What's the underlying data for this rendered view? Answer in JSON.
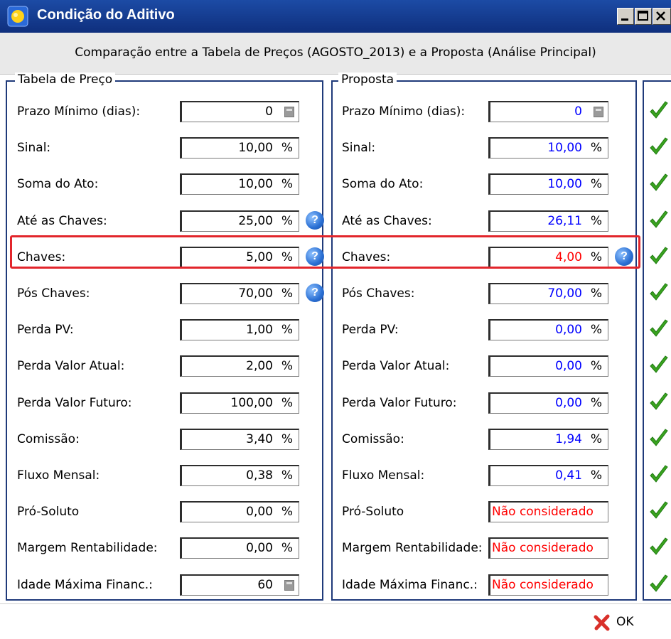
{
  "window": {
    "title": "Condição do Aditivo"
  },
  "header": {
    "subtitle": "Comparação entre a Tabela de Preços (AGOSTO_2013) e a Proposta (Análise Principal)"
  },
  "tabela": {
    "legend": "Tabela de Preço",
    "rows": [
      {
        "label": "Prazo Mínimo (dias):",
        "value": "0",
        "unit": ""
      },
      {
        "label": "Sinal:",
        "value": "10,00",
        "unit": "%"
      },
      {
        "label": "Soma do Ato:",
        "value": "10,00",
        "unit": "%"
      },
      {
        "label": "Até as Chaves:",
        "value": "25,00",
        "unit": "%"
      },
      {
        "label": "Chaves:",
        "value": "5,00",
        "unit": "%"
      },
      {
        "label": "Pós Chaves:",
        "value": "70,00",
        "unit": "%"
      },
      {
        "label": "Perda PV:",
        "value": "1,00",
        "unit": "%"
      },
      {
        "label": "Perda Valor Atual:",
        "value": "2,00",
        "unit": "%"
      },
      {
        "label": "Perda Valor Futuro:",
        "value": "100,00",
        "unit": "%"
      },
      {
        "label": "Comissão:",
        "value": "3,40",
        "unit": "%"
      },
      {
        "label": "Fluxo Mensal:",
        "value": "0,38",
        "unit": "%"
      },
      {
        "label": "Pró-Soluto",
        "value": "0,00",
        "unit": "%"
      },
      {
        "label": "Margem Rentabilidade:",
        "value": "0,00",
        "unit": "%"
      },
      {
        "label": "Idade Máxima Financ.:",
        "value": "60",
        "unit": ""
      }
    ]
  },
  "proposta": {
    "legend": "Proposta",
    "rows": [
      {
        "label": "Prazo Mínimo (dias):",
        "value": "0",
        "unit": ""
      },
      {
        "label": "Sinal:",
        "value": "10,00",
        "unit": "%"
      },
      {
        "label": "Soma do Ato:",
        "value": "10,00",
        "unit": "%"
      },
      {
        "label": "Até as Chaves:",
        "value": "26,11",
        "unit": "%"
      },
      {
        "label": "Chaves:",
        "value": "4,00",
        "unit": "%"
      },
      {
        "label": "Pós Chaves:",
        "value": "70,00",
        "unit": "%"
      },
      {
        "label": "Perda PV:",
        "value": "0,00",
        "unit": "%"
      },
      {
        "label": "Perda Valor Atual:",
        "value": "0,00",
        "unit": "%"
      },
      {
        "label": "Perda Valor Futuro:",
        "value": "0,00",
        "unit": "%"
      },
      {
        "label": "Comissão:",
        "value": "1,94",
        "unit": "%"
      },
      {
        "label": "Fluxo Mensal:",
        "value": "0,41",
        "unit": "%"
      },
      {
        "label": "Pró-Soluto",
        "value": "Não considerado",
        "unit": ""
      },
      {
        "label": "Margem Rentabilidade:",
        "value": "Não considerado",
        "unit": ""
      },
      {
        "label": "Idade Máxima Financ.:",
        "value": "Não considerado",
        "unit": ""
      }
    ]
  },
  "footer": {
    "ok_label": "OK"
  },
  "icons": {
    "help": "help-icon",
    "calc": "calculator-icon",
    "check": "checkmark-icon",
    "close": "x-icon"
  },
  "colors": {
    "value_blue": "#0000ff",
    "value_red": "#ff0000",
    "highlight": "#e2252b",
    "check_green": "#3aa31f"
  }
}
